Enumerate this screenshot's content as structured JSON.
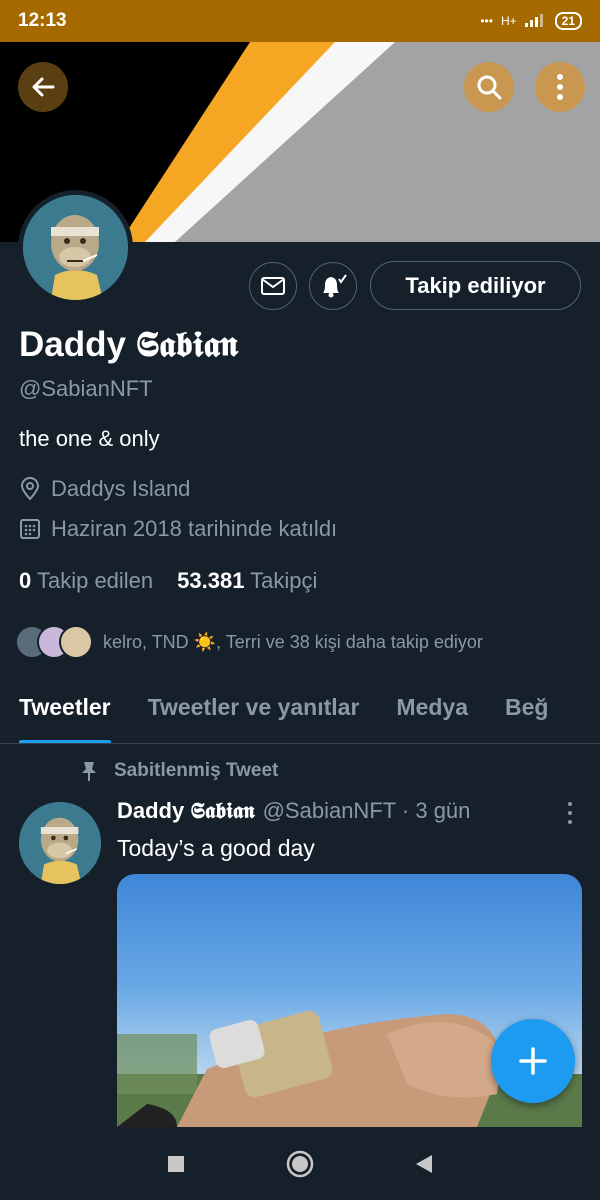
{
  "status_bar": {
    "time": "12:13",
    "network": "H+",
    "battery": "21"
  },
  "profile": {
    "name": "Daddy 𝕾𝖆𝖇𝖎𝖆𝖓",
    "handle": "@SabianNFT",
    "bio": "the one & only",
    "location": "Daddys Island",
    "joined": "Haziran 2018 tarihinde katıldı",
    "following_count": "0",
    "following_label": "Takip edilen",
    "followers_count": "53.381",
    "followers_label": "Takipçi",
    "known_followers_text": "kelro, TND ☀️, Terri ve 38 kişi daha takip ediyor"
  },
  "actions": {
    "follow_label": "Takip ediliyor"
  },
  "tabs": [
    {
      "label": "Tweetler",
      "active": true
    },
    {
      "label": "Tweetler ve yanıtlar",
      "active": false
    },
    {
      "label": "Medya",
      "active": false
    },
    {
      "label": "Beğ",
      "active": false
    }
  ],
  "pinned_tweet": {
    "pinned_label": "Sabitlenmiş Tweet",
    "author_name": "Daddy 𝕾𝖆𝖇𝖎𝖆𝖓",
    "author_meta": "@SabianNFT · 3 gün",
    "text": "Today’s a good day"
  },
  "colors": {
    "accent": "#1d9bf0",
    "background": "#15202b",
    "status_bar": "#a46a00",
    "muted_text": "#8b98a5"
  },
  "icons": [
    "back-arrow-icon",
    "search-icon",
    "more-vertical-icon",
    "mail-icon",
    "bell-icon",
    "location-icon",
    "calendar-icon",
    "pin-icon",
    "plus-icon",
    "square-nav-icon",
    "circle-nav-icon",
    "triangle-nav-icon"
  ]
}
